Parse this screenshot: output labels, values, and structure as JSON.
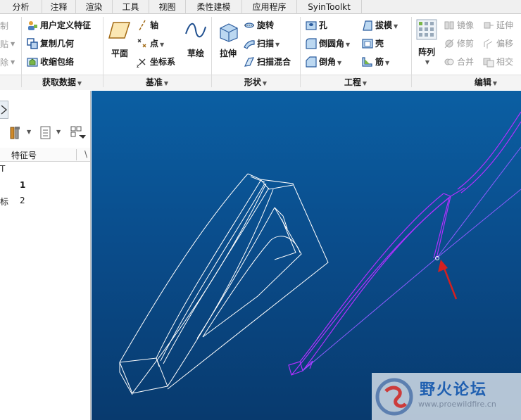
{
  "tabs": [
    "分析",
    "注释",
    "渲染",
    "工具",
    "视图",
    "柔性建模",
    "应用程序",
    "SyinToolkt"
  ],
  "get_data": {
    "clipped_left": [
      "制",
      "贴",
      "除"
    ],
    "items": [
      "用户定义特征",
      "复制几何",
      "收缩包络"
    ],
    "label": "获取数据"
  },
  "datum": {
    "plane": "平面",
    "axis": "轴",
    "point": "点",
    "csys": "坐标系",
    "sketch": "草绘",
    "label": "基准"
  },
  "shapes": {
    "extrude": "拉伸",
    "revolve": "旋转",
    "sweep": "扫描",
    "swept_blend": "扫描混合",
    "label": "形状"
  },
  "engineering": {
    "hole": "孔",
    "round": "倒圆角",
    "chamfer": "倒角",
    "draft": "拔模",
    "shell": "壳",
    "rib": "筋",
    "label": "工程"
  },
  "editing": {
    "pattern": "阵列",
    "mirror": "镜像",
    "extend": "延伸",
    "trim": "修剪",
    "offset": "偏移",
    "merge": "合并",
    "intersect": "相交",
    "label": "编辑"
  },
  "model_tree": {
    "column_header": "特征号",
    "col_clip": "\\",
    "row_t": "T",
    "row1_no": "1",
    "row2_prefix": "标",
    "row2_no": "2"
  },
  "watermark": {
    "title": "野火论坛",
    "url": "www.proewildfire.cn"
  },
  "colors": {
    "accent_purple": "#b030ff",
    "wire_white": "#ffffff",
    "arrow_red": "#d42020",
    "viewport_top": "#0b5fa3",
    "viewport_bottom": "#083a6e"
  }
}
